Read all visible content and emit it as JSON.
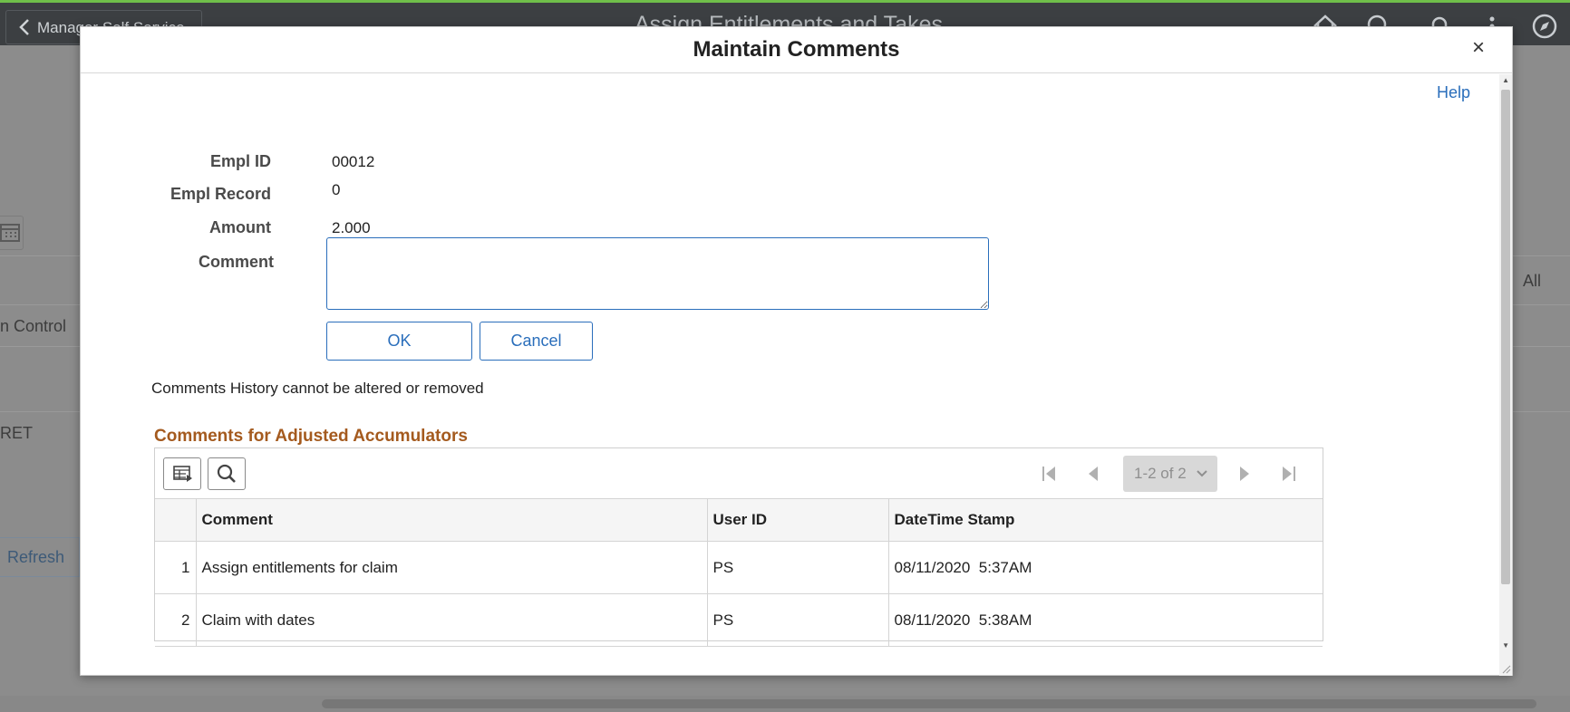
{
  "background": {
    "back_label": "Manager Self Service",
    "page_title": "Assign Entitlements and Takes",
    "control_text": "n Control",
    "ret_text": "RET",
    "all_text": "All",
    "refresh_label": "Refresh"
  },
  "modal": {
    "title": "Maintain Comments",
    "close_glyph": "×",
    "help_label": "Help",
    "fields": {
      "empl_id_label": "Empl ID",
      "empl_id_value": "00012",
      "empl_record_label": "Empl Record",
      "empl_record_value": "0",
      "amount_label": "Amount",
      "amount_value": "2.000",
      "comment_label": "Comment",
      "comment_value": ""
    },
    "ok_label": "OK",
    "cancel_label": "Cancel",
    "history_note": "Comments History cannot be altered or removed",
    "grid": {
      "title": "Comments for Adjusted Accumulators",
      "pagination_label": "1-2 of 2",
      "columns": [
        "",
        "Comment",
        "User ID",
        "DateTime Stamp"
      ],
      "rows": [
        {
          "num": "1",
          "comment": "Assign entitlements for claim",
          "user_id": "PS",
          "datetime": "08/11/2020  5:37AM"
        },
        {
          "num": "2",
          "comment": "Claim with dates",
          "user_id": "PS",
          "datetime": "08/11/2020  5:38AM"
        }
      ]
    }
  },
  "icons": {
    "back": "chevron-left-icon",
    "home": "home-icon",
    "search": "search-icon",
    "notifications": "bell-icon",
    "actions": "more-vertical-icon",
    "navbar": "compass-icon",
    "close": "close-icon",
    "grid_personalize": "grid-personalize-icon",
    "grid_find": "search-icon",
    "first": "first-page-icon",
    "prev": "previous-page-icon",
    "next": "next-page-icon",
    "last": "last-page-icon",
    "dropdown": "chevron-down-icon"
  },
  "colors": {
    "link": "#2a6ebb",
    "grid_title": "#a45a1e",
    "header_bg": "#3c3f42"
  }
}
